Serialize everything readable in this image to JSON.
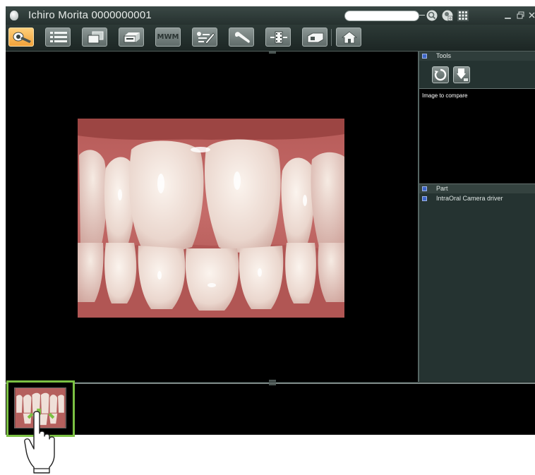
{
  "window": {
    "title": "Ichiro Morita   0000000001",
    "search_placeholder": "",
    "controls": [
      "minimize-icon",
      "restore-icon",
      "close-icon"
    ]
  },
  "toolbar": {
    "buttons": [
      {
        "name": "camera-button",
        "icon": "intraoral-camera-icon",
        "active": true
      },
      {
        "name": "list-button",
        "icon": "list-icon"
      },
      {
        "name": "layers-button",
        "icon": "layers-icon"
      },
      {
        "name": "print-button",
        "icon": "printer-icon"
      },
      {
        "name": "mwm-button",
        "label": "MWM"
      },
      {
        "name": "edit-button",
        "icon": "pen-edit-icon"
      },
      {
        "name": "settings-button",
        "icon": "wrench-icon"
      },
      {
        "name": "export-button",
        "icon": "film-export-icon"
      },
      {
        "name": "device-button",
        "icon": "device-icon"
      },
      {
        "name": "home-button",
        "icon": "home-icon"
      }
    ],
    "mwm_label": "MWM"
  },
  "right_panel": {
    "tools_label": "Tools",
    "tool_buttons": [
      "rotate-icon",
      "save-download-icon"
    ],
    "compare_label": "Image to compare",
    "tree": [
      {
        "label": "Part"
      },
      {
        "label": "IntraOral Camera driver"
      }
    ]
  },
  "thumbnails": [
    {
      "name": "intraoral-thumbnail",
      "selected": true
    }
  ],
  "colors": {
    "accent_selected": "#7bc143",
    "active_tool": "#f0a23a",
    "panel_bg": "#253331"
  }
}
